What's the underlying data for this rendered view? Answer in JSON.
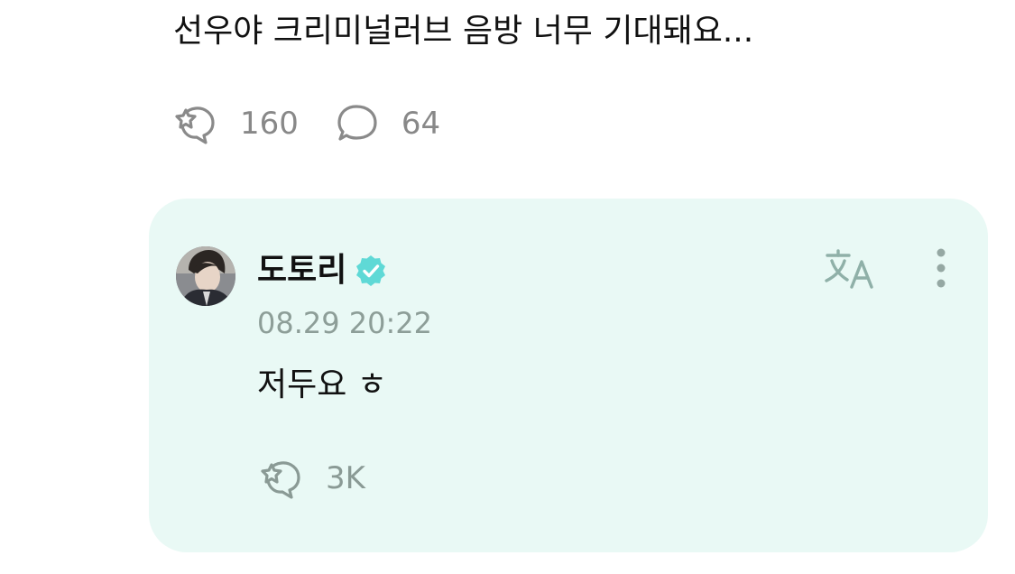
{
  "post": {
    "text": "선우야 크리미널러브 음방 너무 기대돼요...",
    "like_count": "160",
    "comment_count": "64"
  },
  "reply": {
    "author_name": "도토리",
    "timestamp": "08.29 20:22",
    "text": "저두요 ㅎ",
    "like_count": "3K"
  },
  "icons": {
    "like": "star-bubble-icon",
    "comment": "speech-bubble-icon",
    "verified": "verified-badge-icon",
    "translate": "translate-icon",
    "more": "more-vertical-icon"
  },
  "colors": {
    "reply_background": "#e9f9f5",
    "verified_badge": "#5fd9d6",
    "muted_text": "#888888"
  }
}
